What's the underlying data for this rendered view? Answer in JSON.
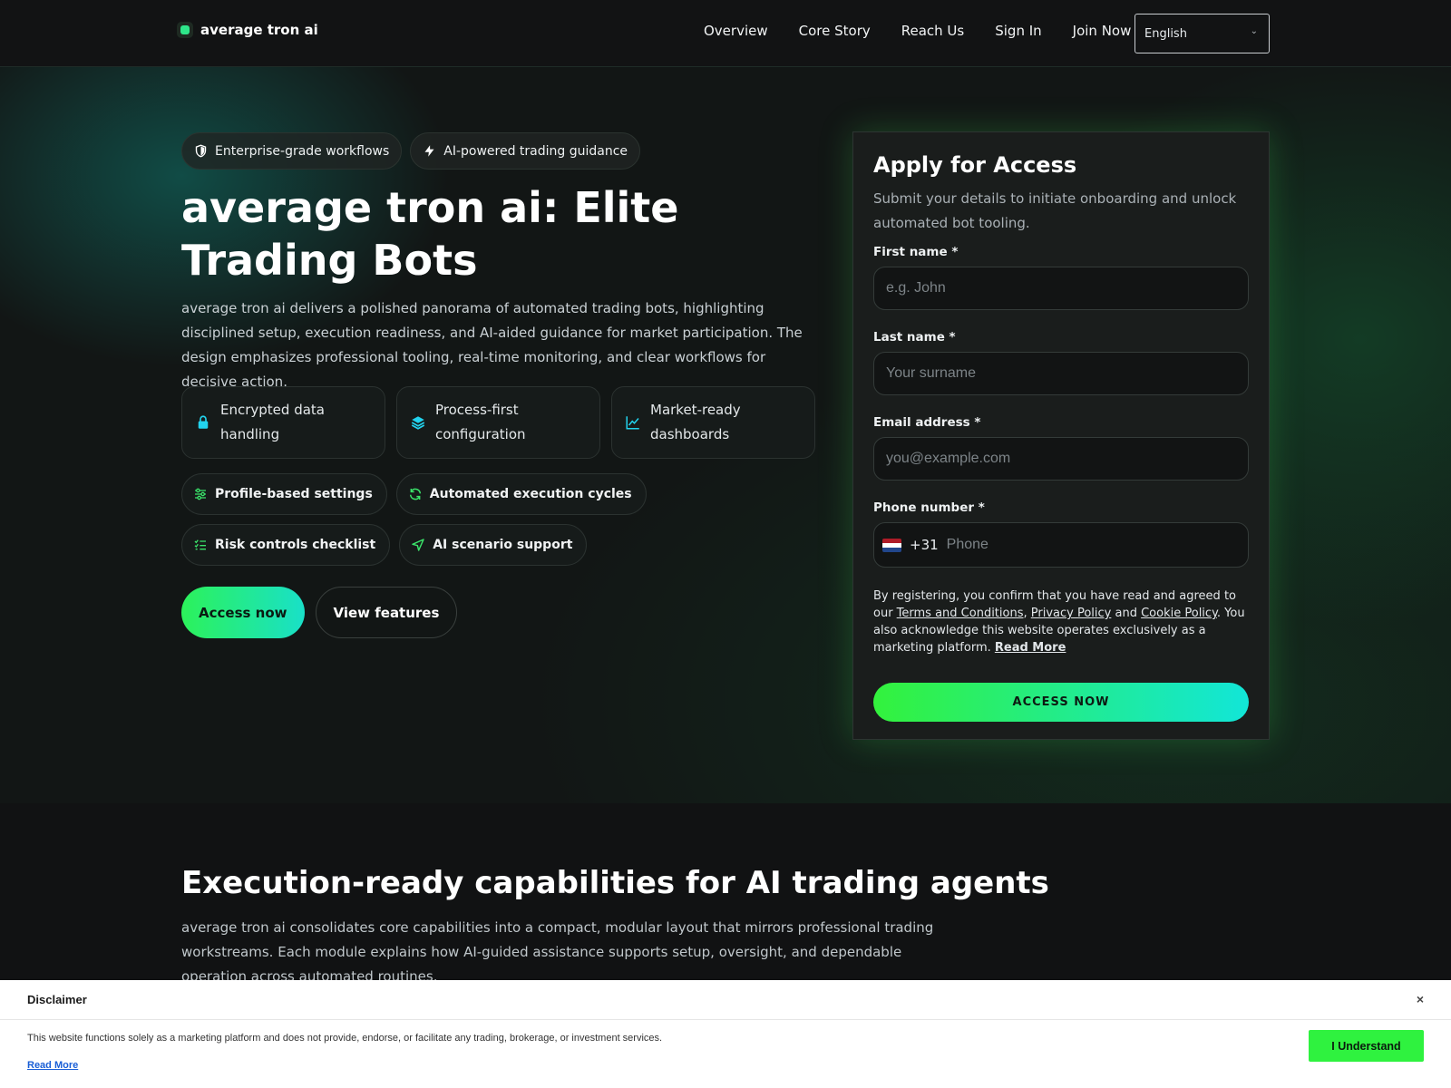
{
  "header": {
    "brand": "average tron ai",
    "nav": [
      "Overview",
      "Core Story",
      "Reach Us",
      "Sign In",
      "Join Now"
    ],
    "language": "English"
  },
  "hero": {
    "pills": [
      {
        "label": "Enterprise-grade workflows",
        "icon": "shield-icon"
      },
      {
        "label": "AI-powered trading guidance",
        "icon": "bolt-icon"
      }
    ],
    "title": "average tron ai: Elite Trading Bots",
    "description": "average tron ai delivers a polished panorama of automated trading bots, highlighting disciplined setup, execution readiness, and AI-aided guidance for market participation. The design emphasizes professional tooling, real-time monitoring, and clear workflows for decisive action.",
    "feature_cards": [
      {
        "label": "Encrypted data handling",
        "icon": "lock-icon"
      },
      {
        "label": "Process-first configuration",
        "icon": "layers-icon"
      },
      {
        "label": "Market-ready dashboards",
        "icon": "line-chart-icon"
      }
    ],
    "chips": [
      {
        "label": "Profile-based settings",
        "icon": "sliders-icon"
      },
      {
        "label": "Automated execution cycles",
        "icon": "refresh-icon"
      },
      {
        "label": "Risk controls checklist",
        "icon": "checklist-icon"
      },
      {
        "label": "AI scenario support",
        "icon": "send-icon"
      }
    ],
    "cta_primary": "Access now",
    "cta_secondary": "View features"
  },
  "form": {
    "title": "Apply for Access",
    "subtitle": "Submit your details to initiate onboarding and unlock automated bot tooling.",
    "first_name_label": "First name *",
    "first_name_placeholder": "e.g. John",
    "last_name_label": "Last name *",
    "last_name_placeholder": "Your surname",
    "email_label": "Email address *",
    "email_placeholder": "you@example.com",
    "phone_label": "Phone number *",
    "phone_dial": "+31",
    "phone_placeholder": "Phone",
    "legal_prefix": "By registering, you confirm that you have read and agreed to our ",
    "terms": "Terms and Conditions",
    "sep1": ", ",
    "privacy": "Privacy Policy",
    "sep2": " and ",
    "cookie": "Cookie Policy",
    "legal_suffix": ". You also acknowledge this website operates exclusively as a marketing platform. ",
    "read_more": "Read More",
    "submit": "ACCESS NOW"
  },
  "capabilities": {
    "title": "Execution-ready capabilities for AI trading agents",
    "description": "average tron ai consolidates core capabilities into a compact, modular layout that mirrors professional trading workstreams. Each module explains how AI-guided assistance supports setup, oversight, and dependable operation across automated routines."
  },
  "disclaimer": {
    "title": "Disclaimer",
    "text": "This website functions solely as a marketing platform and does not provide, endorse, or facilitate any trading, brokerage, or investment services.",
    "read_more": "Read More",
    "button": "I Understand",
    "close": "×"
  },
  "colors": {
    "accent_green": "#2ff23f",
    "accent_cyan": "#12e6d8",
    "background": "#111213",
    "icon_cyan": "#22d3ee",
    "icon_green": "#3be36a"
  }
}
